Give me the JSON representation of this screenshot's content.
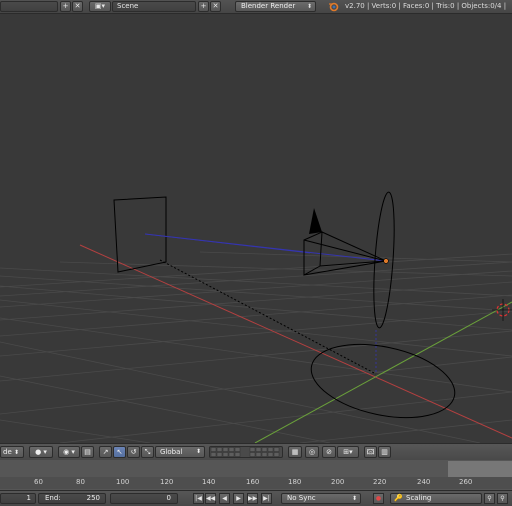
{
  "top_header": {
    "scene_label": "Scene",
    "render_engine": "Blender Render",
    "stats": "v2.70 | Verts:0 | Faces:0 | Tris:0 | Objects:0/4 |"
  },
  "view_header": {
    "view_menu_label": "de",
    "orientation_label": "Global"
  },
  "timeline": {
    "ticks": [
      "60",
      "80",
      "100",
      "120",
      "140",
      "160",
      "180",
      "200",
      "220",
      "240",
      "260"
    ]
  },
  "bottom_header": {
    "start_value": "1",
    "end_label": "End:",
    "end_value": "250",
    "current_frame": "0",
    "sync_label": "No Sync",
    "keying_set_label": "Scaling"
  },
  "colors": {
    "viewport_bg": "#393939",
    "x_axis": "#b34040",
    "y_axis": "#6aa03a",
    "line_blue": "#3535b0",
    "accent_orange": "#e07a2a"
  }
}
